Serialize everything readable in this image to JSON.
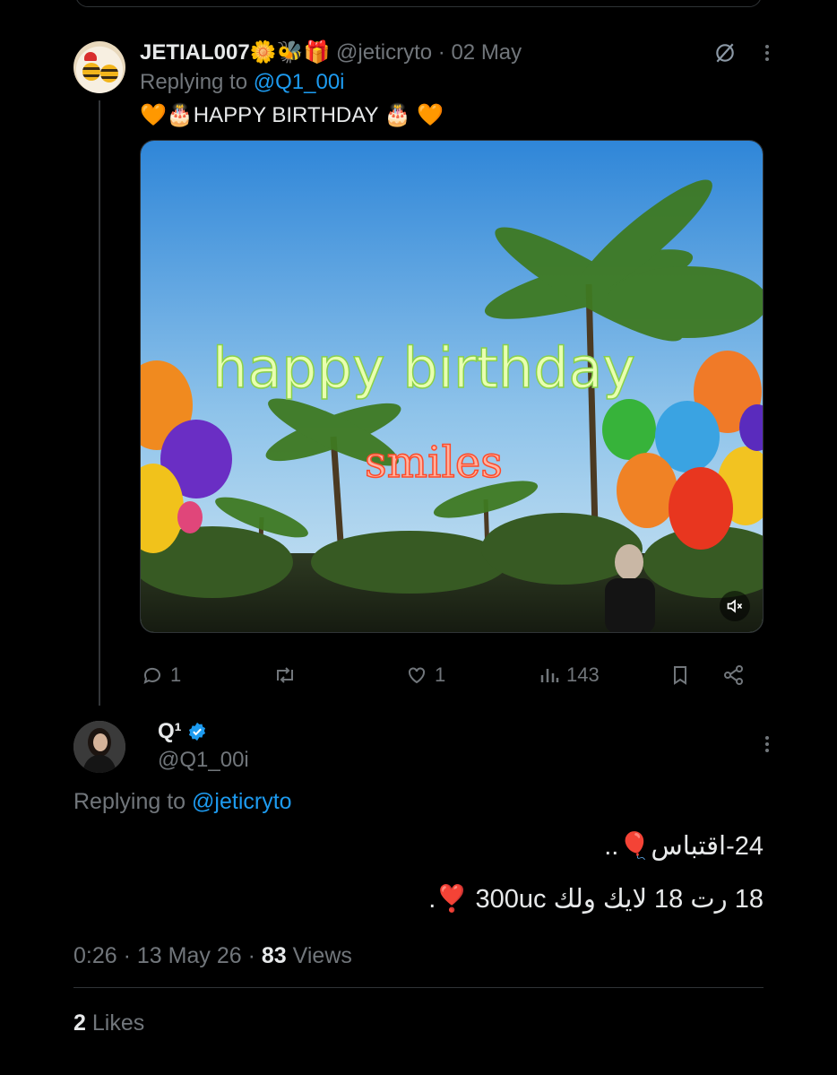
{
  "reply": {
    "author_name": "JETIAL007🌼🐝🎁",
    "handle": "@jeticryto",
    "separator": "·",
    "date": "02 May",
    "replying_prefix": "Replying to",
    "replying_to": "@Q1_00i",
    "text": "🧡🎂HAPPY BIRTHDAY 🎂 🧡",
    "media_caption": "happy birthday",
    "media_subcaption": "smiles",
    "actions": {
      "replies": "1",
      "reposts": "",
      "likes": "1",
      "views": "143"
    }
  },
  "main": {
    "author_name": "Q¹",
    "handle": "@Q1_00i",
    "replying_prefix": "Replying to",
    "replying_to": "@jeticryto",
    "line1": "24-اقتباس🎈..",
    "line2": "18 رت 18 لايك ولك 300uc ❣️.",
    "time": "0:26",
    "dot1": "·",
    "date": "13 May 26",
    "dot2": "·",
    "views_count": "83",
    "views_label": "Views",
    "likes_count": "2",
    "likes_label": "Likes"
  },
  "colors": {
    "background": "#000000",
    "text": "#e7e9ea",
    "muted": "#71767b",
    "link": "#1d9bf0",
    "verified": "#1d9bf0"
  },
  "icons": [
    "grok-icon",
    "more-icon",
    "reply-icon",
    "repost-icon",
    "like-icon",
    "views-icon",
    "bookmark-icon",
    "share-icon",
    "mute-icon",
    "verified-badge-icon"
  ]
}
